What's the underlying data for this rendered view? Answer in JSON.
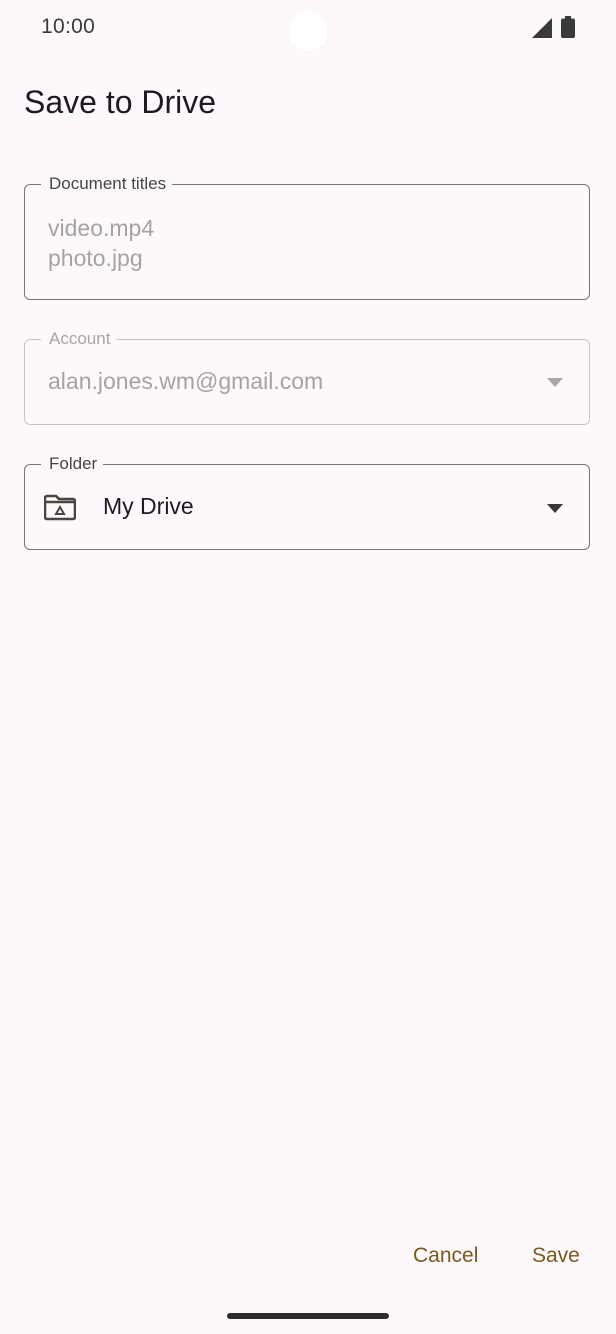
{
  "status_bar": {
    "time": "10:00",
    "icons": [
      "signal-icon",
      "battery-icon"
    ]
  },
  "page": {
    "title": "Save to Drive"
  },
  "document_titles": {
    "label": "Document titles",
    "values": [
      "video.mp4",
      "photo.jpg"
    ]
  },
  "account": {
    "label": "Account",
    "value": "alan.jones.wm@gmail.com",
    "icon": "chevron-down-icon"
  },
  "folder": {
    "label": "Folder",
    "value": "My Drive",
    "icon": "drive-folder-icon"
  },
  "actions": {
    "cancel_label": "Cancel",
    "save_label": "Save"
  },
  "colors": {
    "background": "#fdf8fb",
    "accent": "#7a5a1c",
    "outline": "#7a756f",
    "disabled_text": "#a5a3a2"
  }
}
